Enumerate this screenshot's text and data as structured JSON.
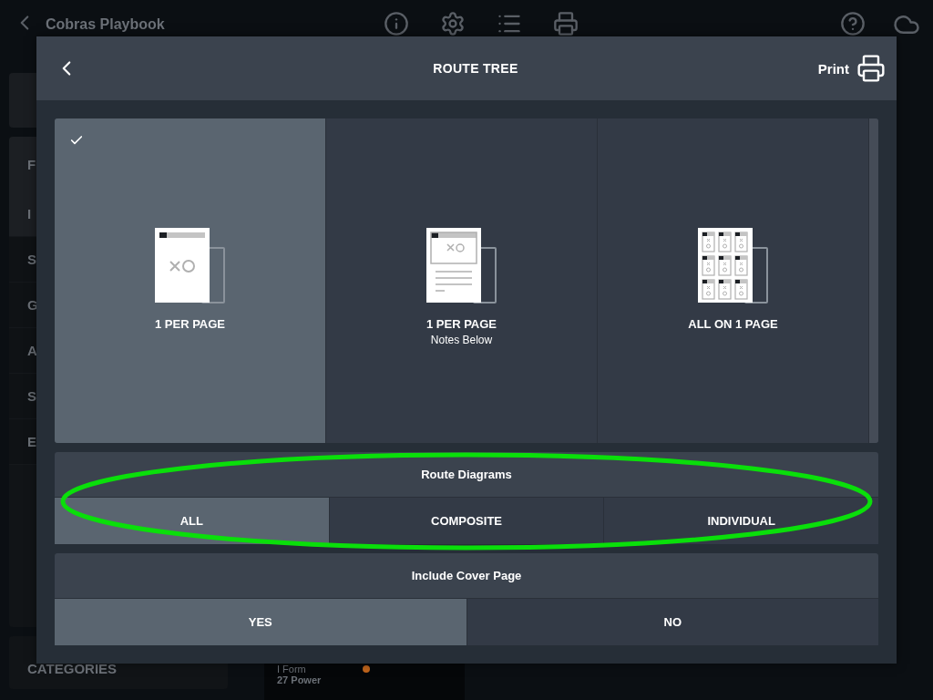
{
  "app": {
    "title": "Cobras Playbook",
    "sidebar": {
      "heading": "F",
      "items": [
        {
          "label": "I",
          "selected": true
        },
        {
          "label": "S",
          "selected": false
        },
        {
          "label": "G",
          "selected": false
        },
        {
          "label": "A",
          "selected": false
        },
        {
          "label": "S",
          "selected": false
        },
        {
          "label": "E",
          "selected": false
        }
      ]
    },
    "categories_label": "CATEGORIES",
    "card": {
      "subtitle": "I Form",
      "title": "27 Power"
    }
  },
  "dialog": {
    "title": "ROUTE TREE",
    "print_label": "Print",
    "layouts": [
      {
        "kind": "single",
        "label": "1 PER PAGE",
        "selected": true
      },
      {
        "kind": "notes",
        "label": "1 PER PAGE",
        "sublabel": "Notes Below",
        "selected": false
      },
      {
        "kind": "grid",
        "label": "ALL ON 1 PAGE",
        "selected": false
      }
    ],
    "sections": [
      {
        "title": "Route Diagrams",
        "highlighted": true,
        "options": [
          {
            "label": "ALL",
            "selected": true
          },
          {
            "label": "COMPOSITE",
            "selected": false
          },
          {
            "label": "INDIVIDUAL",
            "selected": false
          }
        ]
      },
      {
        "title": "Include Cover Page",
        "highlighted": false,
        "options": [
          {
            "label": "YES",
            "selected": true
          },
          {
            "label": "NO",
            "selected": false
          }
        ]
      }
    ]
  }
}
